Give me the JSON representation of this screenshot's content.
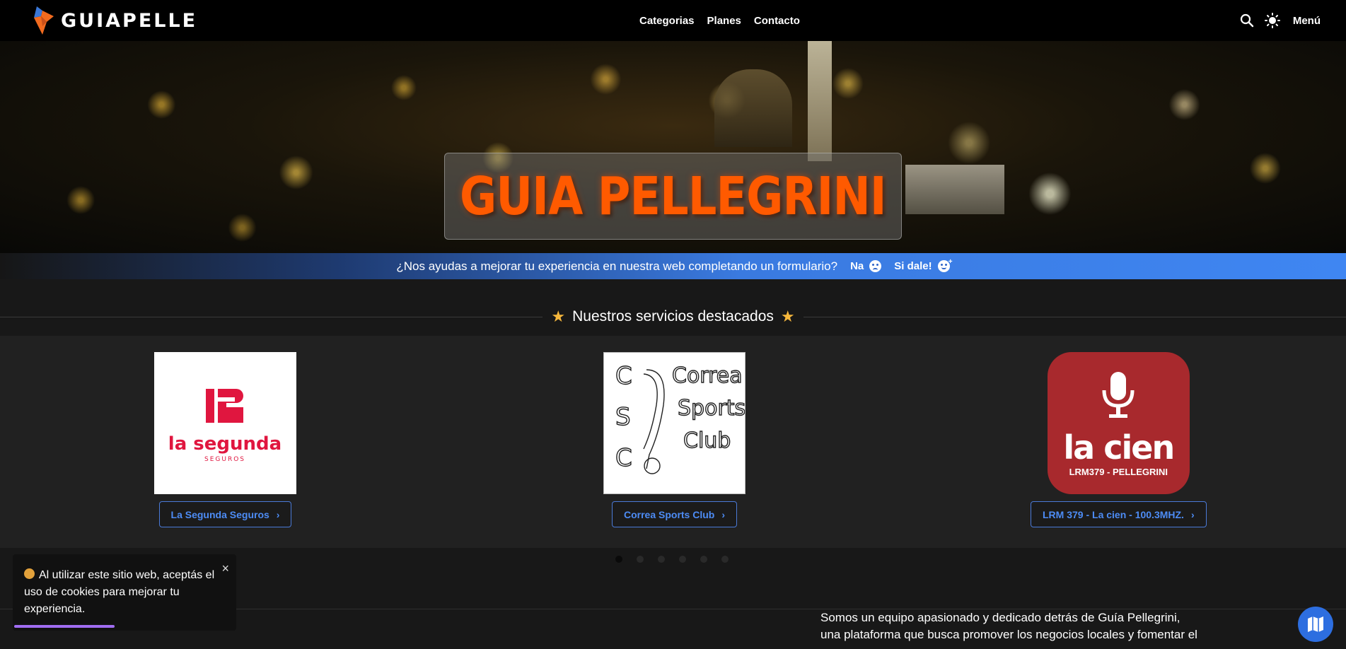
{
  "navbar": {
    "brand_text": "GUIAPELLE",
    "links": [
      "Categorias",
      "Planes",
      "Contacto"
    ],
    "menu_label": "Menú",
    "icons": {
      "search": "search-icon",
      "theme": "sun-icon"
    }
  },
  "hero": {
    "title": "GUIA PELLEGRINI"
  },
  "feedback": {
    "question": "¿Nos ayudas a mejorar tu experiencia en nuestra web completando un formulario?",
    "no_label": "Na",
    "yes_label": "Si dale!"
  },
  "featured": {
    "heading": "Nuestros servicios destacados",
    "cards": [
      {
        "name": "La Segunda Seguros",
        "logo_line1": "la segunda",
        "logo_line2": "SEGUROS"
      },
      {
        "name": "Correa Sports Club",
        "logo_words": [
          "Correa",
          "Sports",
          "Club"
        ],
        "logo_letters": [
          "C",
          "S",
          "C"
        ]
      },
      {
        "name": "LRM 379 - La cien - 100.3MHZ.",
        "logo_main": "la cien",
        "logo_sub": "LRM379 - PELLEGRINI"
      }
    ],
    "dots": 6,
    "active_dot": 1
  },
  "about": {
    "text": "Somos un equipo apasionado y dedicado detrás de Guía Pellegrini, una plataforma que busca promover los negocios locales y fomentar el"
  },
  "cookie": {
    "text": "Al utilizar este sitio web, aceptás el uso de cookies para mejorar tu experiencia.",
    "close": "×",
    "progress": 0.45
  },
  "colors": {
    "accent": "#ff5a00",
    "link_blue": "#4d8cf5",
    "feedback_blue": "#3f86f2",
    "star": "#f6b73c",
    "cien_red": "#a8292d",
    "segunda_red": "#e0163f"
  }
}
